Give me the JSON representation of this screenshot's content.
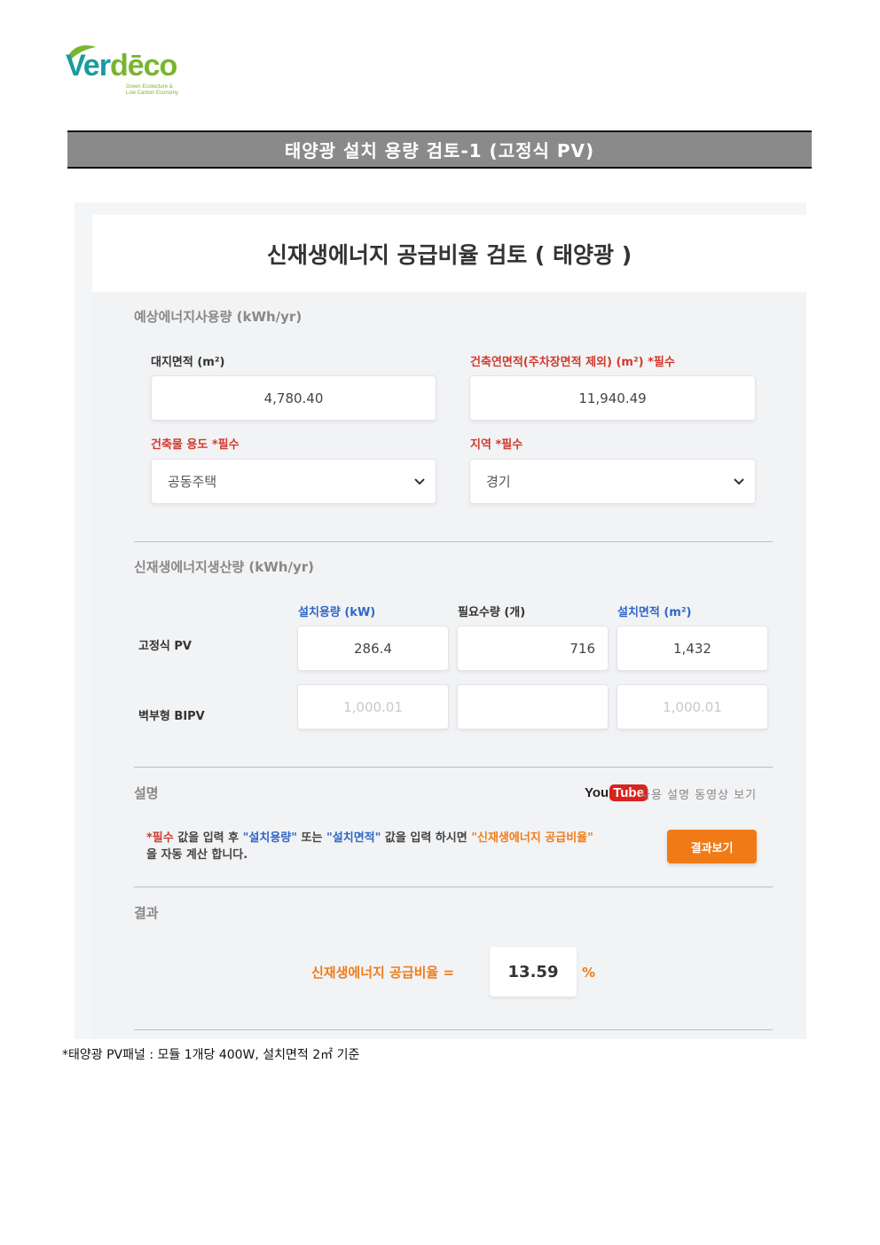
{
  "logo": {
    "word_part1": "Ver",
    "word_part2": "dēco",
    "tagline_line1": "Green Ecotecture &",
    "tagline_line2": "Low Carbon Economy"
  },
  "page_title": "태양광 설치 용량 검토-1 (고정식 PV)",
  "panel_title": "신재생에너지 공급비율 검토 ( 태양광 )",
  "energy_use": {
    "section": "예상에너지사용량 (kWh/yr)",
    "site_area_label": "대지면적 (m²)",
    "site_area_value": "4,780.40",
    "floor_area_label": "건축연면적(주차장면적 제외) (m²) *필수",
    "floor_area_value": "11,940.49",
    "building_use_label": "건축물 용도 *필수",
    "building_use_value": "공동주택",
    "region_label": "지역 *필수",
    "region_value": "경기"
  },
  "production": {
    "section": "신재생에너지생산량 (kWh/yr)",
    "col_capacity": "설치용량 (kW)",
    "col_quantity": "필요수량 (개)",
    "col_area": "설치면적 (m²)",
    "rows": [
      {
        "label": "고정식 PV",
        "capacity": "286.4",
        "quantity": "716",
        "area": "1,432"
      },
      {
        "label": "벽부형 BIPV",
        "capacity": "1,000.01",
        "quantity": "",
        "area": "1,000.01"
      }
    ]
  },
  "explanation": {
    "section": "설명",
    "youtube_you": "You",
    "youtube_tube": "Tube",
    "video_link": "사용 설명 동영상 보기",
    "desc_required": "*필수",
    "desc_t1": " 값을 입력 후 ",
    "desc_capacity": "\"설치용량\"",
    "desc_t2": " 또는 ",
    "desc_area": "\"설치면적\"",
    "desc_t3": " 값을 입력 하시면 ",
    "desc_ratio": "\"신재생에너지 공급비율\"",
    "desc_t4": " 을 자동 계산 합니다.",
    "button": "결과보기"
  },
  "result": {
    "section": "결과",
    "label": "신재생에너지 공급비율 =",
    "value": "13.59",
    "unit": "%"
  },
  "footnote": "*태양광 PV패널 : 모듈 1개당 400W, 설치면적 2㎡ 기준",
  "colors": {
    "accent_orange": "#f07b16",
    "required_red": "#d03a2e",
    "label_blue": "#2f66c6",
    "title_bar_gray": "#8a8a8a"
  }
}
